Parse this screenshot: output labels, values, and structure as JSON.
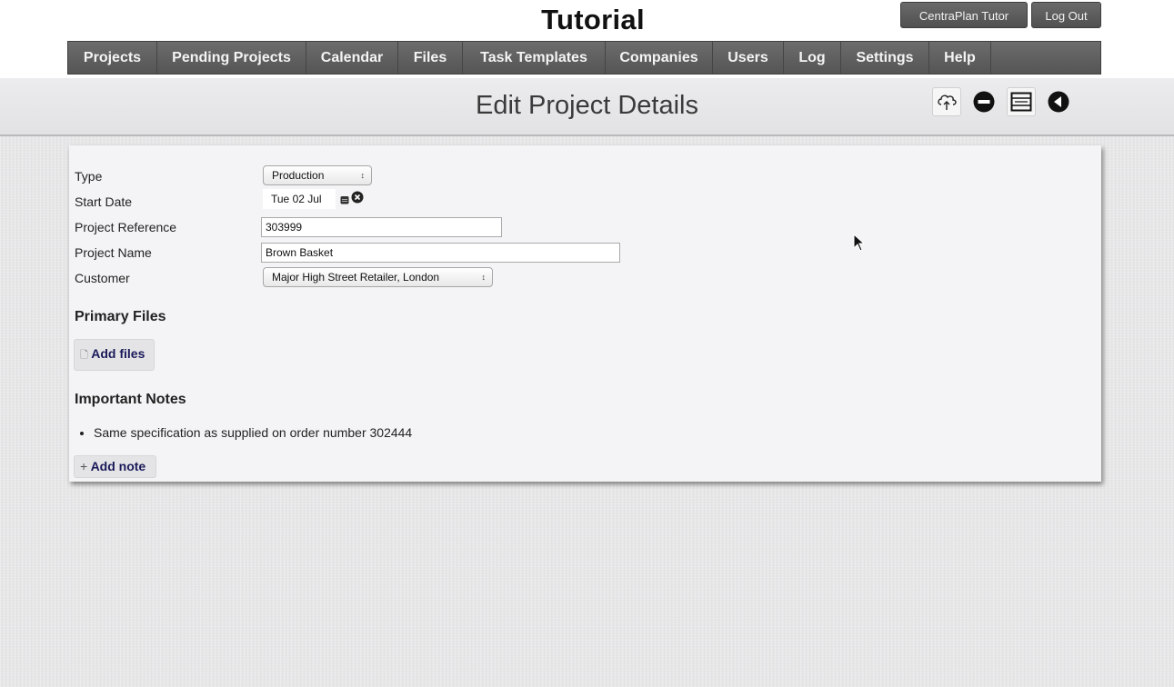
{
  "app": {
    "title": "Tutorial",
    "account_button": "CentraPlan Tutor",
    "logout_button": "Log Out"
  },
  "nav": {
    "items": [
      {
        "label": "Projects"
      },
      {
        "label": "Pending Projects"
      },
      {
        "label": "Calendar"
      },
      {
        "label": "Files"
      },
      {
        "label": "Task Templates"
      },
      {
        "label": "Companies"
      },
      {
        "label": "Users"
      },
      {
        "label": "Log"
      },
      {
        "label": "Settings"
      },
      {
        "label": "Help"
      }
    ]
  },
  "page": {
    "title": "Edit Project Details",
    "toolbar_icons": [
      "upload-cloud-icon",
      "remove-icon",
      "template-icon",
      "back-icon"
    ]
  },
  "form": {
    "type_label": "Type",
    "type_value": "Production",
    "start_date_label": "Start Date",
    "start_date_value": "Tue 02 Jul",
    "reference_label": "Project Reference",
    "reference_value": "303999",
    "name_label": "Project Name",
    "name_value": "Brown Basket",
    "customer_label": "Customer",
    "customer_value": "Major High Street Retailer, London"
  },
  "files": {
    "heading": "Primary Files",
    "add_label": "Add files"
  },
  "notes": {
    "heading": "Important Notes",
    "items": [
      "Same specification as supplied on order number 302444"
    ],
    "add_label": "Add note"
  },
  "colors": {
    "nav_bg": "#5e5e5e",
    "panel_bg": "#f4f4f6",
    "page_bg": "#e8e8e9",
    "link_text": "#1a1a5a"
  }
}
